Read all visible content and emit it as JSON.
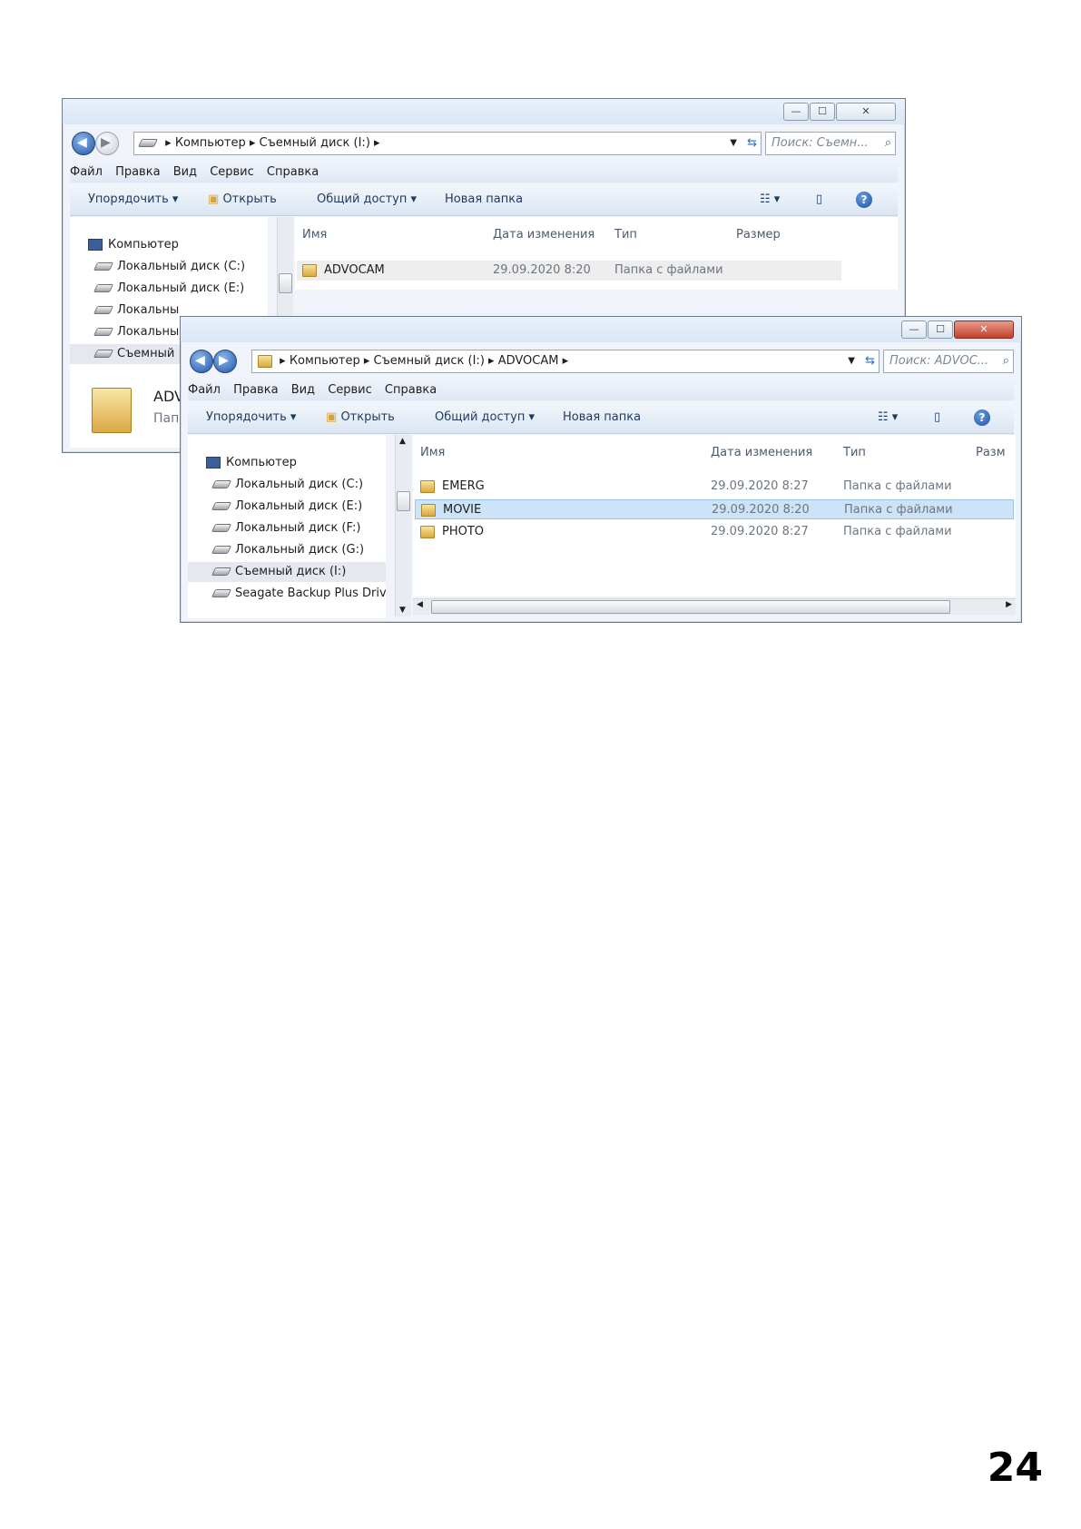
{
  "page_number": "24",
  "back_window": {
    "controls": {
      "minimize": "—",
      "maximize": "☐",
      "close": "✕"
    },
    "breadcrumb": [
      "Компьютер",
      "Съемный диск (I:)"
    ],
    "search_placeholder": "Поиск: Съемн...",
    "menu": [
      "Файл",
      "Правка",
      "Вид",
      "Сервис",
      "Справка"
    ],
    "commands": {
      "organize": "Упорядочить",
      "open": "Открыть",
      "share": "Общий доступ",
      "new_folder": "Новая папка"
    },
    "nav": [
      "Компьютер",
      "Локальный диск (C:)",
      "Локальный диск (E:)",
      "Локальны",
      "Локальны",
      "Съемный"
    ],
    "columns": {
      "name": "Имя",
      "date": "Дата изменения",
      "type": "Тип",
      "size": "Размер"
    },
    "rows": [
      {
        "name": "ADVOCAM",
        "date": "29.09.2020 8:20",
        "type": "Папка с файлами"
      }
    ],
    "details": {
      "name": "ADV",
      "type": "Пап"
    }
  },
  "front_window": {
    "controls": {
      "minimize": "—",
      "maximize": "☐",
      "close": "✕"
    },
    "breadcrumb": [
      "Компьютер",
      "Съемный диск (I:)",
      "ADVOCAM"
    ],
    "search_placeholder": "Поиск: ADVOC...",
    "menu": [
      "Файл",
      "Правка",
      "Вид",
      "Сервис",
      "Справка"
    ],
    "commands": {
      "organize": "Упорядочить",
      "open": "Открыть",
      "share": "Общий доступ",
      "new_folder": "Новая папка"
    },
    "nav": [
      "Компьютер",
      "Локальный диск (C:)",
      "Локальный диск (E:)",
      "Локальный диск (F:)",
      "Локальный диск (G:)",
      "Съемный диск (I:)",
      "Seagate Backup Plus Drive"
    ],
    "columns": {
      "name": "Имя",
      "date": "Дата изменения",
      "type": "Тип",
      "size": "Разм"
    },
    "rows": [
      {
        "name": "EMERG",
        "date": "29.09.2020 8:27",
        "type": "Папка с файлами"
      },
      {
        "name": "MOVIE",
        "date": "29.09.2020 8:20",
        "type": "Папка с файлами"
      },
      {
        "name": "PHOTO",
        "date": "29.09.2020 8:27",
        "type": "Папка с файлами"
      }
    ],
    "selected_row": "MOVIE"
  }
}
